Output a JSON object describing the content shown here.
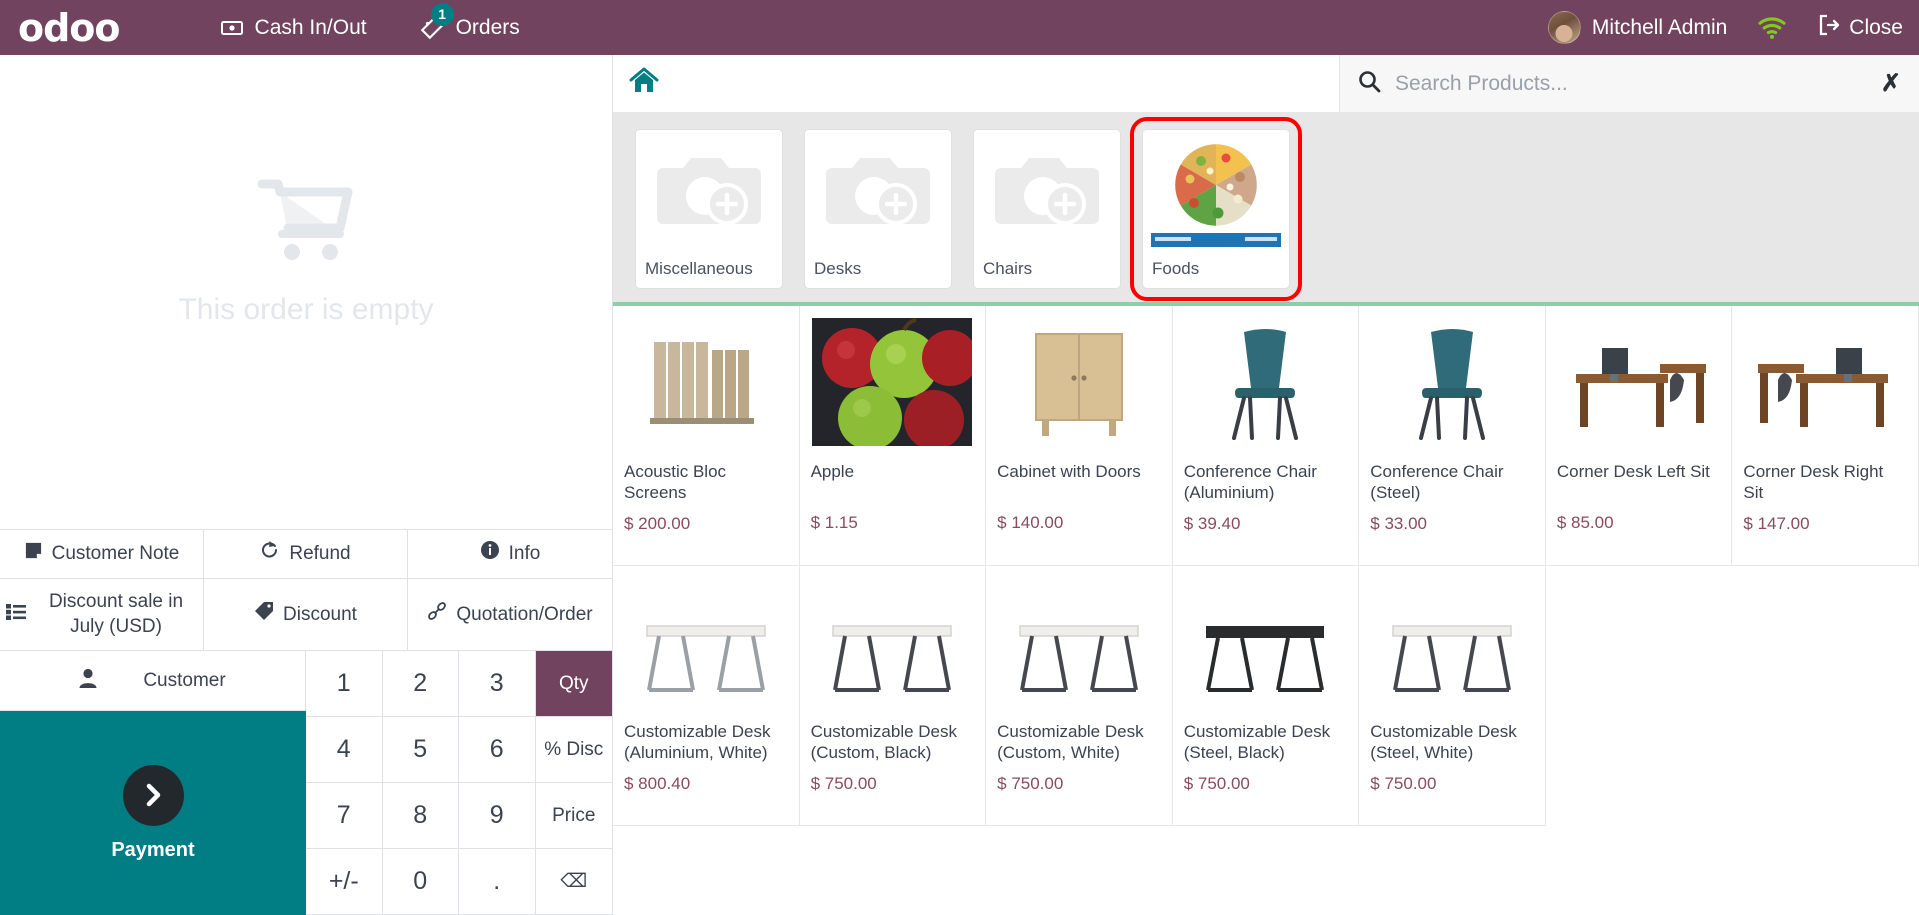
{
  "topbar": {
    "brand": "odoo",
    "items": [
      {
        "label": "Cash In/Out",
        "icon": "cash-icon",
        "badge": null
      },
      {
        "label": "Orders",
        "icon": "orders-icon",
        "badge": "1"
      }
    ],
    "user": "Mitchell Admin",
    "wifi_icon": "wifi-icon",
    "wifi_color": "#82c91e",
    "close_label": "Close"
  },
  "order": {
    "empty_text": "This order is empty",
    "cart_icon": "shopping-cart-icon"
  },
  "actions": [
    {
      "label": "Customer Note",
      "icon": "note-icon"
    },
    {
      "label": "Refund",
      "icon": "refund-icon"
    },
    {
      "label": "Info",
      "icon": "info-icon"
    },
    {
      "label": "Discount sale in July (USD)",
      "icon": "list-icon"
    },
    {
      "label": "Discount",
      "icon": "tag-icon"
    },
    {
      "label": "Quotation/Order",
      "icon": "link-icon"
    }
  ],
  "customer": {
    "label": "Customer",
    "icon": "person-icon"
  },
  "payment": {
    "label": "Payment",
    "icon": "chevron-right-icon"
  },
  "numpad": {
    "keys": [
      {
        "label": "1",
        "type": "digit",
        "active": false
      },
      {
        "label": "2",
        "type": "digit",
        "active": false
      },
      {
        "label": "3",
        "type": "digit",
        "active": false
      },
      {
        "label": "Qty",
        "type": "mode",
        "active": true
      },
      {
        "label": "4",
        "type": "digit",
        "active": false
      },
      {
        "label": "5",
        "type": "digit",
        "active": false
      },
      {
        "label": "6",
        "type": "digit",
        "active": false
      },
      {
        "label": "% Disc",
        "type": "mode",
        "active": false
      },
      {
        "label": "7",
        "type": "digit",
        "active": false
      },
      {
        "label": "8",
        "type": "digit",
        "active": false
      },
      {
        "label": "9",
        "type": "digit",
        "active": false
      },
      {
        "label": "Price",
        "type": "mode",
        "active": false
      },
      {
        "label": "+/-",
        "type": "digit",
        "active": false
      },
      {
        "label": "0",
        "type": "digit",
        "active": false
      },
      {
        "label": ".",
        "type": "digit",
        "active": false
      },
      {
        "label": "⌫",
        "type": "mode",
        "active": false
      }
    ]
  },
  "search": {
    "placeholder": "Search Products...",
    "value": "",
    "icon": "search-icon",
    "clear_icon": "close-icon"
  },
  "home": {
    "icon": "home-icon",
    "color": "#017e84"
  },
  "categories": [
    {
      "name": "Miscellaneous",
      "image": "placeholder",
      "selected": false
    },
    {
      "name": "Desks",
      "image": "placeholder",
      "selected": false
    },
    {
      "name": "Chairs",
      "image": "placeholder",
      "selected": false
    },
    {
      "name": "Foods",
      "image": "food-platter",
      "selected": true
    }
  ],
  "products": [
    {
      "name": "Acoustic Bloc Screens",
      "price": "$ 200.00",
      "image": "screen"
    },
    {
      "name": "Apple",
      "price": "$ 1.15",
      "image": "apples"
    },
    {
      "name": "Cabinet with Doors",
      "price": "$ 140.00",
      "image": "cabinet"
    },
    {
      "name": "Conference Chair (Aluminium)",
      "price": "$ 39.40",
      "image": "chair-blue"
    },
    {
      "name": "Conference Chair (Steel)",
      "price": "$ 33.00",
      "image": "chair-blue"
    },
    {
      "name": "Corner Desk Left Sit",
      "price": "$ 85.00",
      "image": "desk-corner"
    },
    {
      "name": "Corner Desk Right Sit",
      "price": "$ 147.00",
      "image": "desk-corner"
    },
    {
      "name": "Customizable Desk (Aluminium, White)",
      "price": "$ 800.40",
      "image": "desk-white"
    },
    {
      "name": "Customizable Desk (Custom, Black)",
      "price": "$ 750.00",
      "image": "desk-white"
    },
    {
      "name": "Customizable Desk (Custom, White)",
      "price": "$ 750.00",
      "image": "desk-white"
    },
    {
      "name": "Customizable Desk (Steel, Black)",
      "price": "$ 750.00",
      "image": "desk-black"
    },
    {
      "name": "Customizable Desk (Steel, White)",
      "price": "$ 750.00",
      "image": "desk-white"
    }
  ],
  "colors": {
    "brand_purple": "#71435f",
    "teal": "#017e84",
    "price": "#8b4a5e",
    "highlight_red": "#ff0000",
    "green_divider": "#8ecfab"
  }
}
